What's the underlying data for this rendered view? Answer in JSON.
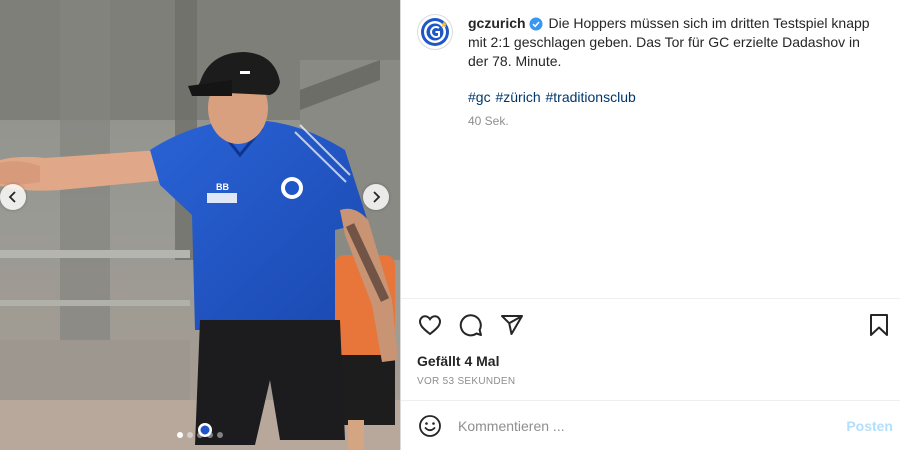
{
  "post": {
    "author": {
      "username": "gczurich",
      "verified": true,
      "avatar_icon": "gc-club-logo"
    },
    "caption": "Die Hoppers müssen sich im dritten Testspiel knapp mit 2:1 geschlagen geben. Das Tor für GC erzielte Dadashov in der 78. Minute.",
    "hashtags": [
      "#gc",
      "#zürich",
      "#traditionsclub"
    ],
    "caption_time": "40 Sek.",
    "likes_label": "Gefällt 4 Mal",
    "posted_time": "VOR 53 SEKUNDEN"
  },
  "media": {
    "carousel_count": 5,
    "active_index": 0,
    "shirt_text": "BB",
    "prev_icon": "chevron-left-icon",
    "next_icon": "chevron-right-icon"
  },
  "actions": {
    "like_icon": "heart-icon",
    "comment_icon": "comment-icon",
    "share_icon": "send-icon",
    "save_icon": "bookmark-icon"
  },
  "comment_box": {
    "placeholder": "Kommentieren ...",
    "post_label": "Posten",
    "emoji_icon": "smiley-icon"
  },
  "colors": {
    "verified_badge": "#3897f0",
    "hashtag": "#00376b",
    "post_button_disabled": "#b2dffc",
    "jersey_blue": "#1f56c8"
  }
}
